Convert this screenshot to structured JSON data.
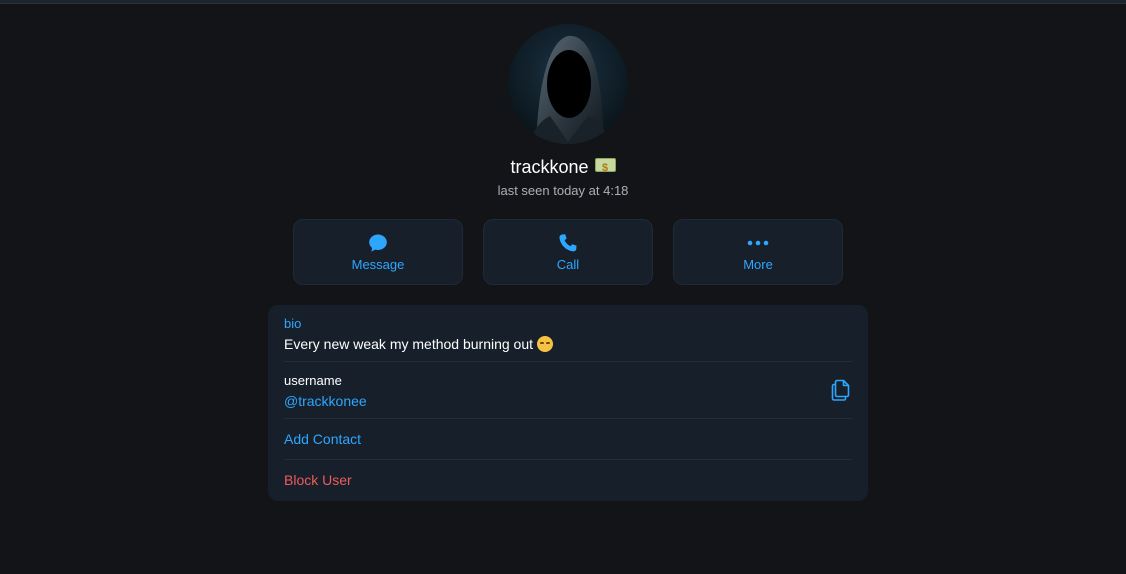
{
  "profile": {
    "name": "trackkone",
    "name_emoji": "money-with-wings-emoji",
    "status": "last seen today at 4:18",
    "avatar": "hooded-figure-avatar"
  },
  "actions": [
    {
      "label": "Message",
      "icon": "message-bubble-icon"
    },
    {
      "label": "Call",
      "icon": "phone-icon"
    },
    {
      "label": "More",
      "icon": "more-dots-icon"
    }
  ],
  "info": {
    "bio_label": "bio",
    "bio_text": "Every new weak my method burning out",
    "bio_emoji": "face-emoji",
    "username_label": "username",
    "username_value": "@trackkonee",
    "copy_icon": "copy-icon",
    "add_contact": "Add Contact",
    "block_user": "Block User"
  },
  "colors": {
    "background": "#131417",
    "card": "#17202a",
    "accent": "#2ea6ff",
    "danger": "#ef5b5b",
    "muted_text": "#aab0b8"
  }
}
